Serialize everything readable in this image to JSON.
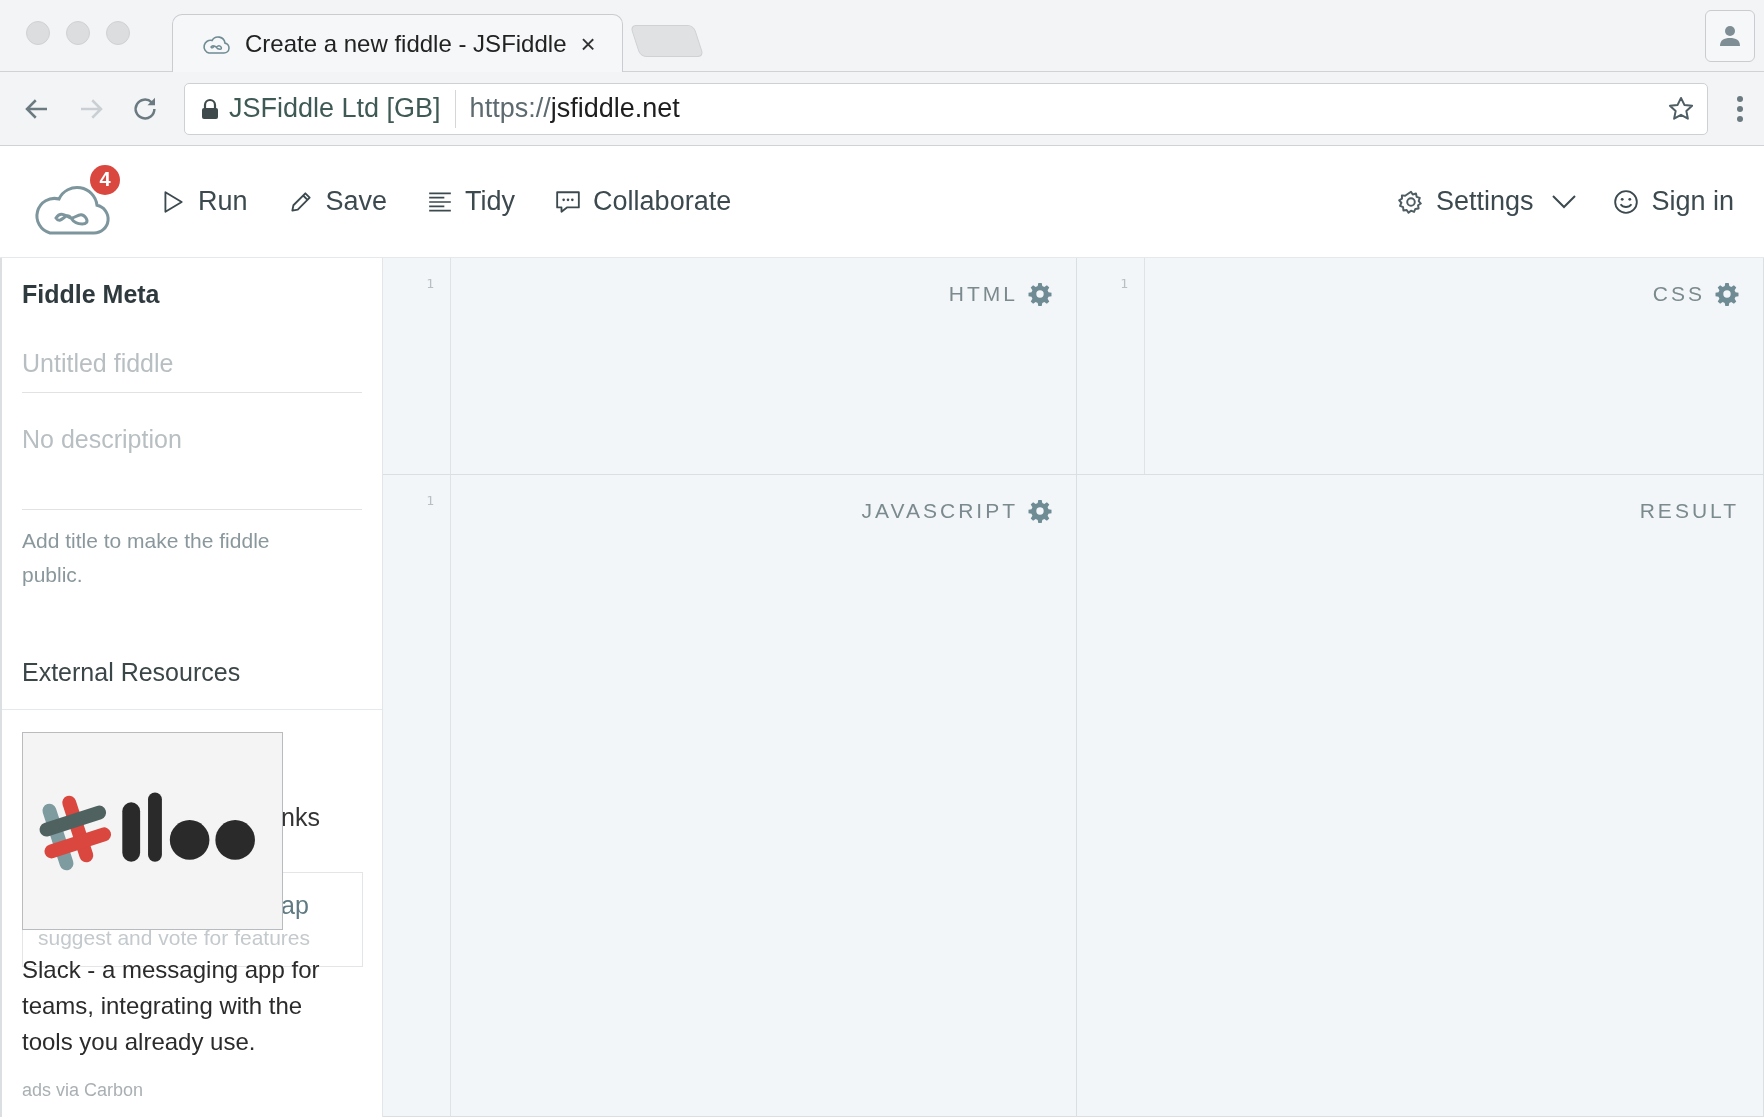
{
  "browser": {
    "tab": {
      "title": "Create a new fiddle - JSFiddle",
      "close": "×"
    },
    "address": {
      "security_label": "JSFiddle Ltd [GB]",
      "url_scheme": "https://",
      "url_host": "jsfiddle.net"
    }
  },
  "toolbar": {
    "notification_count": "4",
    "actions": [
      {
        "label": "Run",
        "kind": "run"
      },
      {
        "label": "Save",
        "kind": "save"
      },
      {
        "label": "Tidy",
        "kind": "tidy"
      },
      {
        "label": "Collaborate",
        "kind": "collaborate"
      }
    ],
    "settings": "Settings",
    "sign_in": "Sign in"
  },
  "sidebar": {
    "title": "Fiddle Meta",
    "title_field": {
      "placeholder": "Untitled fiddle"
    },
    "description_field": {
      "placeholder": "No description"
    },
    "hint": "Add title to make the fiddle public.",
    "external_resources": "External Resources",
    "covered_link": "nks",
    "covered_box": {
      "title": "ap",
      "subtitle": "suggest and vote for features"
    },
    "ad": {
      "kind": "picture",
      "text": "Slack - a messaging app for teams, integrating with the tools you already use.",
      "credit": "ads via Carbon"
    }
  },
  "panels": [
    {
      "label": "HTML",
      "line_number": "1",
      "settings": true
    },
    {
      "label": "CSS",
      "line_number": "1",
      "settings": true
    },
    {
      "label": "JAVASCRIPT",
      "line_number": "1",
      "settings": true
    },
    {
      "label": "RESULT",
      "settings": false
    }
  ]
}
